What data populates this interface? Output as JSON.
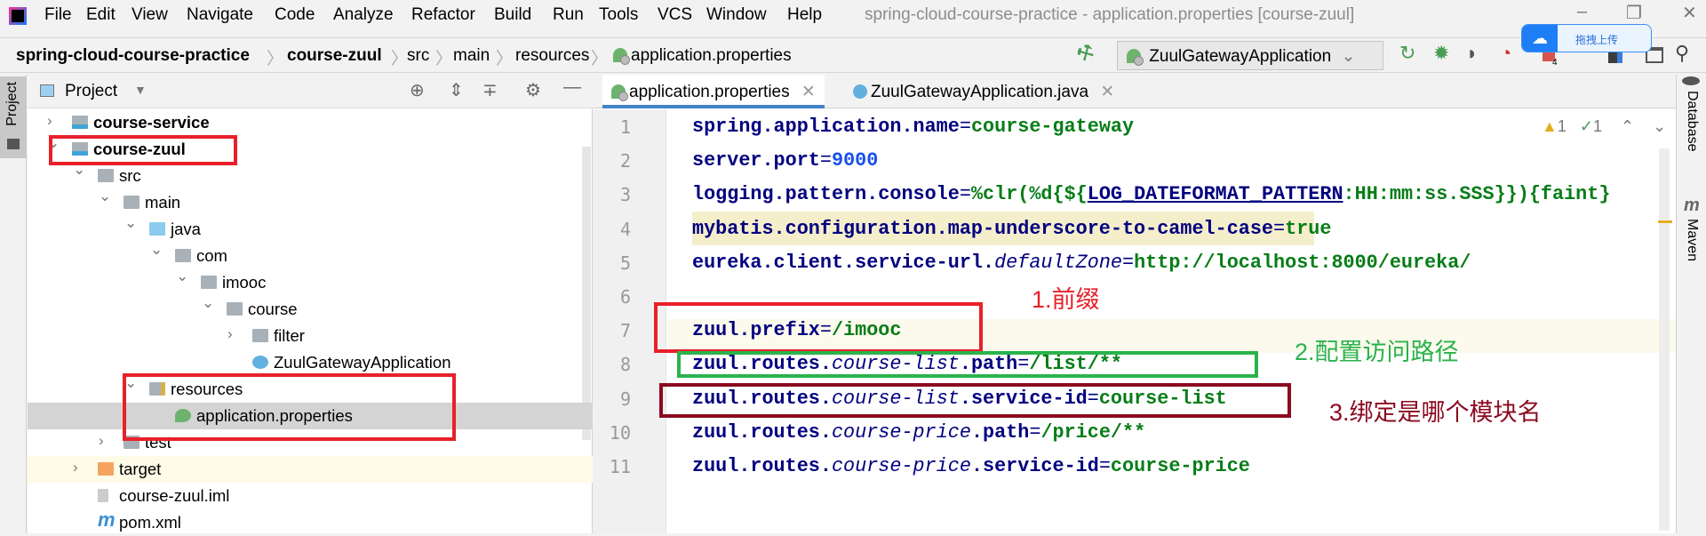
{
  "menu": {
    "items": [
      "File",
      "Edit",
      "View",
      "Navigate",
      "Code",
      "Analyze",
      "Refactor",
      "Build",
      "Run",
      "Tools",
      "VCS",
      "Window",
      "Help"
    ],
    "title": "spring-cloud-course-practice - application.properties [course-zuul]"
  },
  "breadcrumb": [
    "spring-cloud-course-practice",
    "course-zuul",
    "src",
    "main",
    "resources",
    "application.properties"
  ],
  "toolbar": {
    "run_config": "ZuulGatewayApplication",
    "badge": "4"
  },
  "upload_widget": {
    "label": "拖拽上传"
  },
  "project": {
    "title": "Project",
    "tab": "Project",
    "tree": [
      {
        "label": "course-service",
        "level": 0,
        "arrow": "right",
        "icon": "module-folder",
        "bold": true
      },
      {
        "label": "course-zuul",
        "level": 0,
        "arrow": "down",
        "icon": "module-folder",
        "bold": true
      },
      {
        "label": "src",
        "level": 1,
        "arrow": "down",
        "icon": "folder"
      },
      {
        "label": "main",
        "level": 2,
        "arrow": "down",
        "icon": "folder"
      },
      {
        "label": "java",
        "level": 3,
        "arrow": "down",
        "icon": "source-folder"
      },
      {
        "label": "com",
        "level": 4,
        "arrow": "down",
        "icon": "package"
      },
      {
        "label": "imooc",
        "level": 5,
        "arrow": "down",
        "icon": "package"
      },
      {
        "label": "course",
        "level": 6,
        "arrow": "down",
        "icon": "package"
      },
      {
        "label": "filter",
        "level": 7,
        "arrow": "right",
        "icon": "package"
      },
      {
        "label": "ZuulGatewayApplication",
        "level": 7,
        "arrow": "",
        "icon": "spring-class"
      },
      {
        "label": "resources",
        "level": 3,
        "arrow": "down",
        "icon": "resources-folder"
      },
      {
        "label": "application.properties",
        "level": 4,
        "arrow": "",
        "icon": "spring-properties",
        "selected": true
      },
      {
        "label": "test",
        "level": 2,
        "arrow": "right",
        "icon": "folder"
      },
      {
        "label": "target",
        "level": 1,
        "arrow": "right",
        "icon": "excluded-folder"
      },
      {
        "label": "course-zuul.iml",
        "level": 1,
        "arrow": "",
        "icon": "iml-file"
      },
      {
        "label": "pom.xml",
        "level": 1,
        "arrow": "",
        "icon": "maven"
      }
    ]
  },
  "editor": {
    "tabs": [
      {
        "label": "application.properties",
        "active": true
      },
      {
        "label": "ZuulGatewayApplication.java",
        "active": false
      }
    ],
    "inspections": {
      "warnings": "1",
      "typos": "1"
    },
    "lines": [
      {
        "n": "1",
        "k": "spring.application.name",
        "e": "=",
        "v": "course-gateway"
      },
      {
        "n": "2",
        "k": "server.port",
        "e": "=",
        "num": "9000"
      },
      {
        "n": "3",
        "k": "logging.pattern.console",
        "e": "=",
        "v1": "%clr(%d{${",
        "u": "LOG_DATEFORMAT_PATTERN",
        "v": ":HH:mm:ss.SSS}}){faint}"
      },
      {
        "n": "4",
        "k": "mybatis.configuration.map-underscore-to-camel-case",
        "e": "=",
        "v": "true"
      },
      {
        "n": "5",
        "k": "eureka.client.service-url.",
        "i": "defaultZone",
        "e": "=",
        "v": "http://localhost:8000/eureka/"
      },
      {
        "n": "6"
      },
      {
        "n": "7",
        "k": "zuul.prefix",
        "e": "=",
        "v": "/imooc"
      },
      {
        "n": "8",
        "k": "zuul.routes.",
        "i": "course-list",
        "k2": ".path",
        "e": "=",
        "v": "/list/**"
      },
      {
        "n": "9",
        "k": "zuul.routes.",
        "i": "course-list",
        "k2": ".service-id",
        "e": "=",
        "v": "course-list"
      },
      {
        "n": "10",
        "k": "zuul.routes.",
        "i": "course-price",
        "k2": ".path",
        "e": "=",
        "v": "/price/**"
      },
      {
        "n": "11",
        "k": "zuul.routes.",
        "i": "course-price",
        "k2": ".service-id",
        "e": "=",
        "v": "course-price"
      }
    ]
  },
  "annotations": [
    {
      "text": "1.前缀",
      "color": "#e8202a"
    },
    {
      "text": "2.配置访问路径",
      "color": "#2bb24c"
    },
    {
      "text": "3.绑定是哪个模块名",
      "color": "#8b0a1f"
    }
  ],
  "right_stripe": [
    "Database",
    "Maven"
  ]
}
